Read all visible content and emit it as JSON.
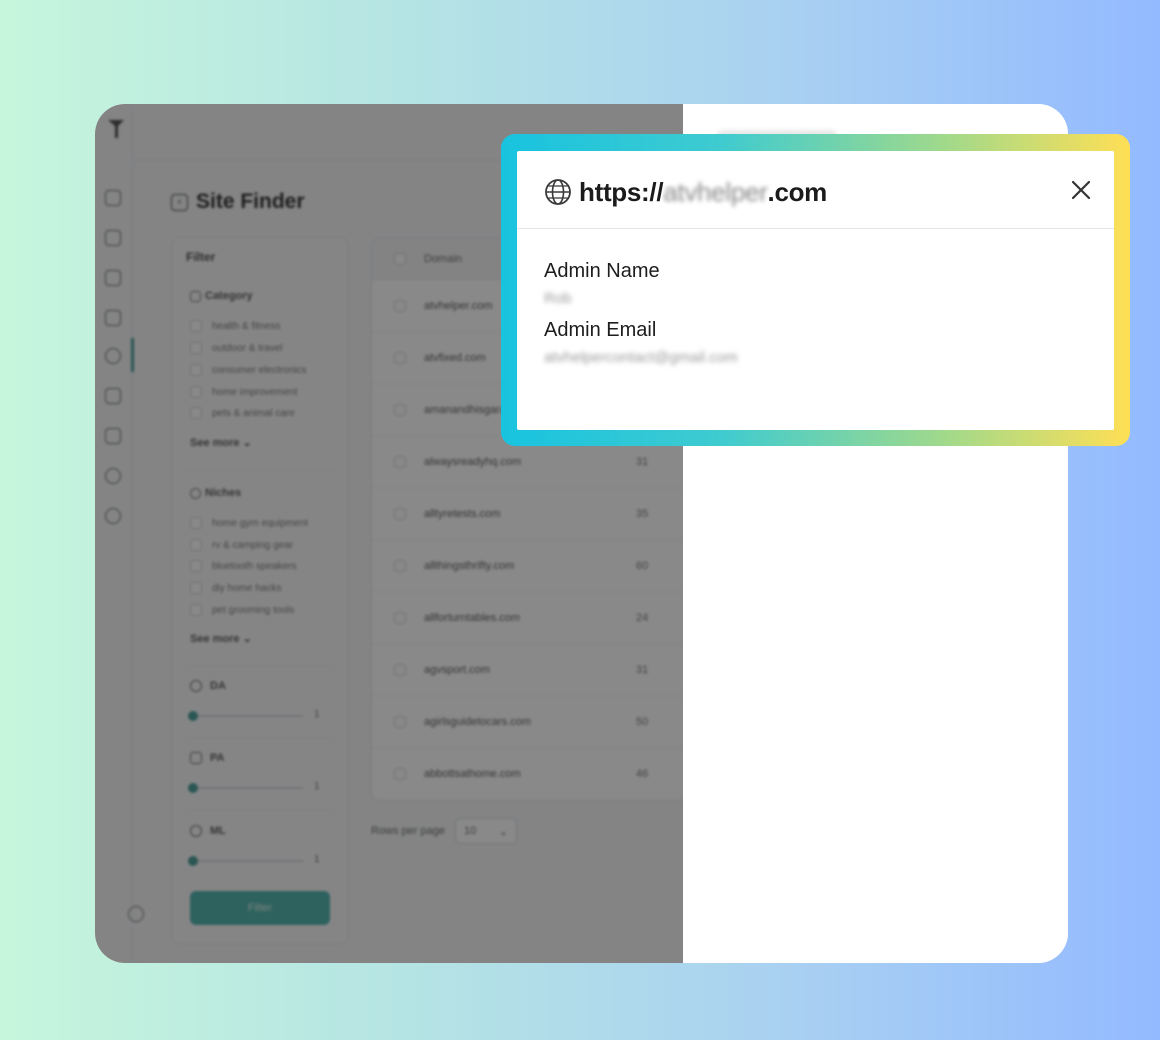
{
  "page": {
    "title": "Site Finder"
  },
  "filter": {
    "heading": "Filter",
    "category": {
      "title": "Category",
      "items": [
        "health & fitness",
        "outdoor & travel",
        "consumer electronics",
        "home improvement",
        "pets & animal care"
      ],
      "see_more": "See more"
    },
    "niches": {
      "title": "Niches",
      "items": [
        "home gym equipment",
        "rv & camping gear",
        "bluetooth speakers",
        "diy home hacks",
        "pet grooming tools"
      ],
      "see_more": "See more"
    },
    "sliders": [
      {
        "label": "DA",
        "value": "1"
      },
      {
        "label": "PA",
        "value": "1"
      },
      {
        "label": "ML",
        "value": "1"
      }
    ],
    "button": "Filter"
  },
  "table": {
    "column_domain": "Domain",
    "rows": [
      {
        "domain": "atvhelper.com",
        "da": ""
      },
      {
        "domain": "atvfixed.com",
        "da": ""
      },
      {
        "domain": "amanandhisgarage.com",
        "da": ""
      },
      {
        "domain": "alwaysreadyhq.com",
        "da": "31"
      },
      {
        "domain": "alltyretests.com",
        "da": "35"
      },
      {
        "domain": "allthingsthrifty.com",
        "da": "60"
      },
      {
        "domain": "allforturntables.com",
        "da": "24"
      },
      {
        "domain": "agvsport.com",
        "da": "31"
      },
      {
        "domain": "agirlsguidetocars.com",
        "da": "50"
      },
      {
        "domain": "abbottsathome.com",
        "da": "46"
      }
    ],
    "rows_per_page_label": "Rows per page",
    "rows_per_page_value": "10"
  },
  "modal": {
    "title_prefix": "https://",
    "title_domain": "atvhelper",
    "title_suffix": ".com",
    "fields": [
      {
        "label": "Admin Name",
        "value": "Rob"
      },
      {
        "label": "Admin Email",
        "value": "atvhelpercontact@gmail.com"
      }
    ]
  },
  "icons": {
    "modal": [
      "globe-icon",
      "close-icon"
    ],
    "rail": [
      "home-icon",
      "folder-icon",
      "inbox-icon",
      "send-icon",
      "globe-icon",
      "grid-icon",
      "network-icon",
      "users-icon",
      "settings-icon"
    ]
  },
  "colors": {
    "accent": "#35a89f",
    "frame_gradient_start": "#18c3df",
    "frame_gradient_end": "#ffdf55"
  }
}
